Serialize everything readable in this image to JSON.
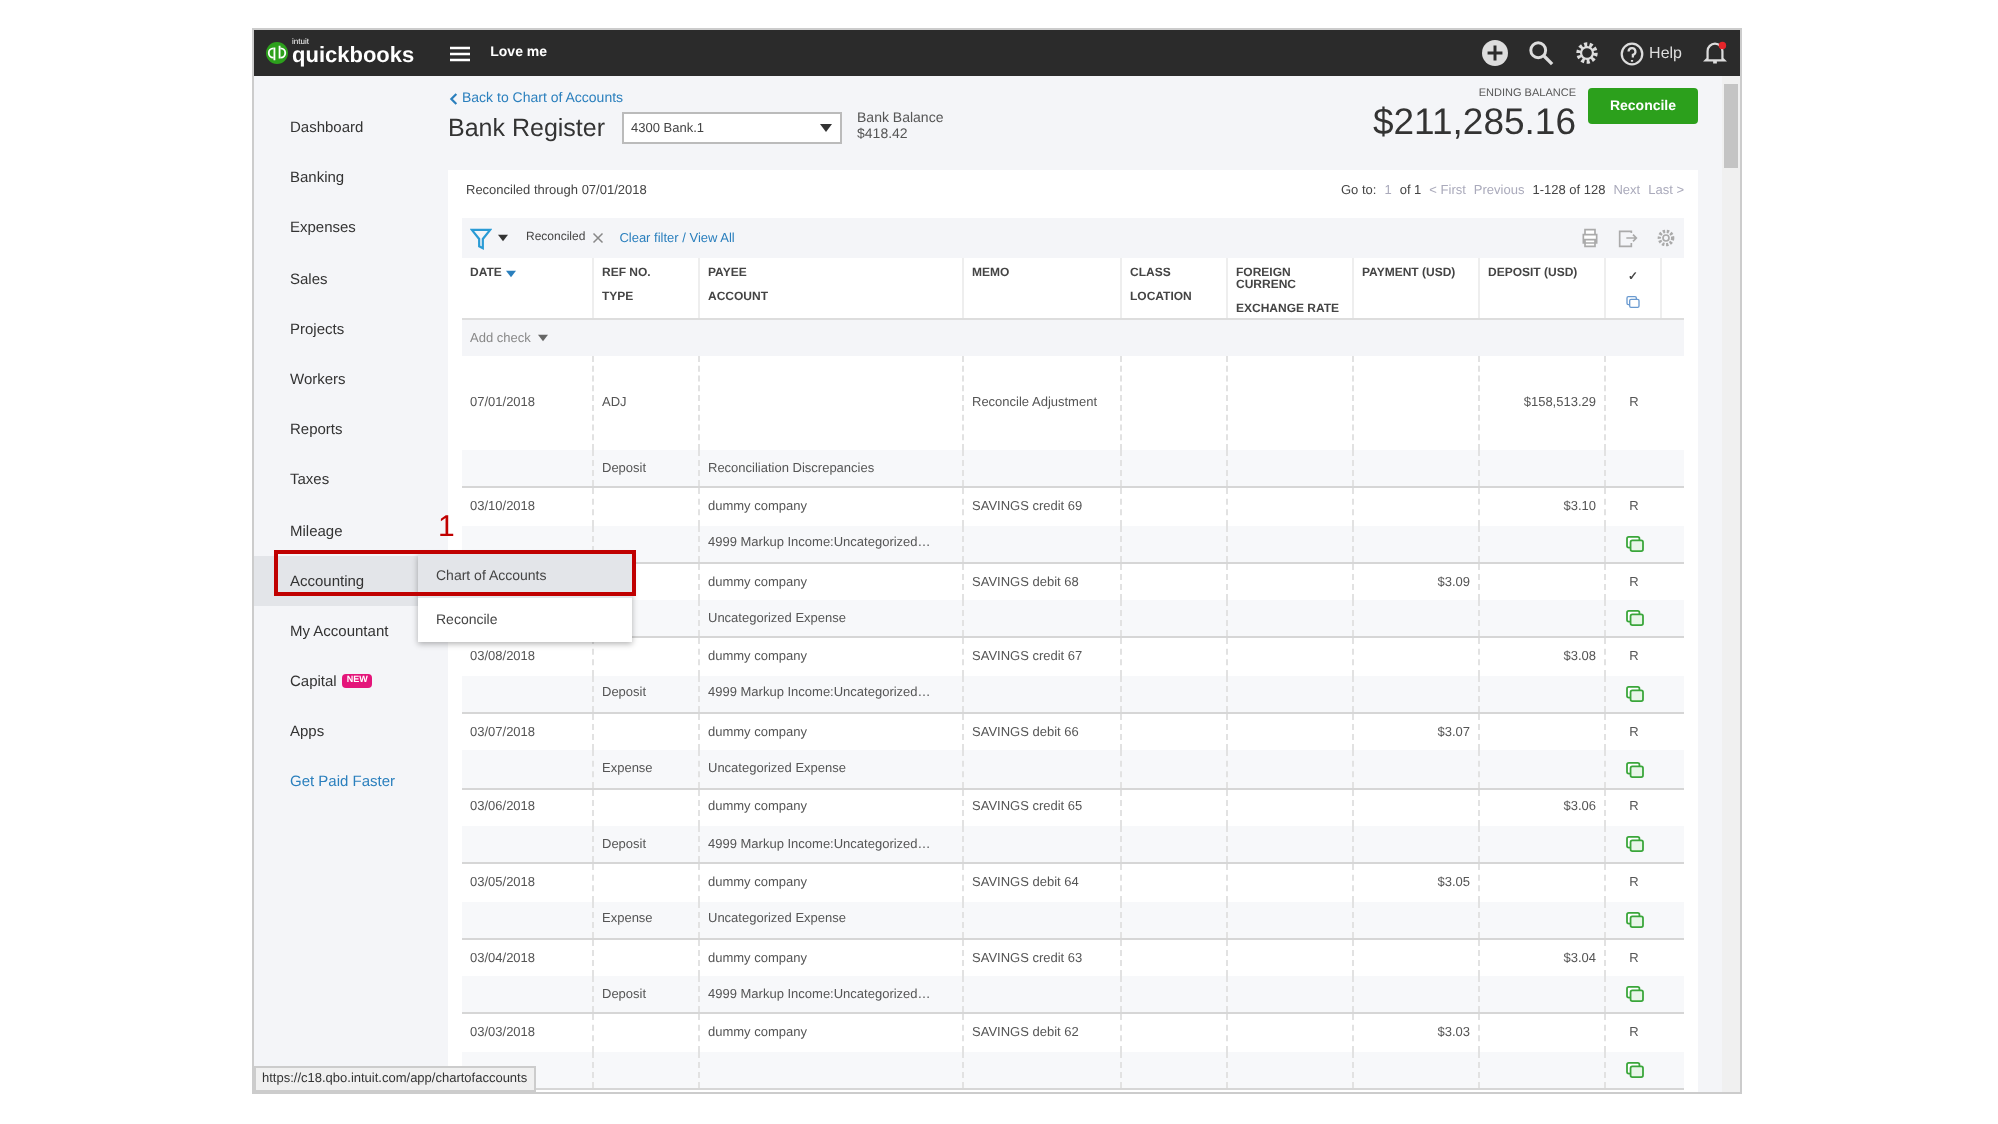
{
  "topbar": {
    "logo_small": "intuit",
    "logo": "quickbooks",
    "company": "Love me",
    "help": "Help",
    "notification": true
  },
  "sidebar": {
    "items": [
      {
        "label": "Dashboard",
        "selected": false,
        "kind": "nav"
      },
      {
        "label": "Banking",
        "selected": false,
        "kind": "nav"
      },
      {
        "label": "Expenses",
        "selected": false,
        "kind": "nav"
      },
      {
        "label": "Sales",
        "selected": false,
        "kind": "nav"
      },
      {
        "label": "Projects",
        "selected": false,
        "kind": "nav"
      },
      {
        "label": "Workers",
        "selected": false,
        "kind": "nav"
      },
      {
        "label": "Reports",
        "selected": false,
        "kind": "nav"
      },
      {
        "label": "Taxes",
        "selected": false,
        "kind": "nav"
      },
      {
        "label": "Mileage",
        "selected": false,
        "kind": "nav"
      },
      {
        "label": "Accounting",
        "selected": true,
        "kind": "nav"
      },
      {
        "label": "My Accountant",
        "selected": false,
        "kind": "nav"
      },
      {
        "label": "Capital",
        "selected": false,
        "kind": "nav",
        "badge": "NEW"
      },
      {
        "label": "Apps",
        "selected": false,
        "kind": "nav"
      },
      {
        "label": "Get Paid Faster",
        "selected": false,
        "kind": "link"
      }
    ]
  },
  "flyout": {
    "items": [
      {
        "label": "Chart of Accounts",
        "selected": true
      },
      {
        "label": "Reconcile",
        "selected": false
      }
    ]
  },
  "annotation": {
    "label": "1"
  },
  "header": {
    "back_link": "Back to Chart of Accounts",
    "title": "Bank Register",
    "account": "4300 Bank.1",
    "bank_balance_label": "Bank Balance",
    "bank_balance": "$418.42",
    "ending_balance_label": "ENDING BALANCE",
    "ending_balance": "$211,285.16",
    "reconcile_button": "Reconcile"
  },
  "pager": {
    "reconciled_through": "Reconciled through 07/01/2018",
    "goto": "Go to:",
    "page": "1",
    "of": "of 1",
    "nav": [
      {
        "label": "< First",
        "disabled": true
      },
      {
        "label": "Previous",
        "disabled": true
      },
      {
        "label": "1-128 of 128",
        "disabled": false
      },
      {
        "label": "Next",
        "disabled": true
      },
      {
        "label": "Last >",
        "disabled": true
      }
    ]
  },
  "filter": {
    "chip": "Reconciled",
    "clear_link": "Clear filter / View All"
  },
  "columns": [
    {
      "line1": "DATE",
      "sorted": true
    },
    {
      "line1": "REF NO.",
      "line2": "TYPE",
      "sorted": false
    },
    {
      "line1": "PAYEE",
      "line2": "ACCOUNT",
      "sorted": false
    },
    {
      "line1": "MEMO",
      "sorted": false
    },
    {
      "line1": "CLASS",
      "line2": "LOCATION",
      "sorted": false
    },
    {
      "line1": "FOREIGN CURRENC",
      "line2": "EXCHANGE RATE",
      "sorted": false
    },
    {
      "line1": "PAYMENT (USD)",
      "sorted": false
    },
    {
      "line1": "DEPOSIT (USD)",
      "sorted": false
    }
  ],
  "check_column": "✓",
  "add_check": "Add check",
  "rows": [
    {
      "kind": "adjustment",
      "date": "07/01/2018",
      "ref": "ADJ",
      "payee": "",
      "memo": "Reconcile Adjustment",
      "payment": "",
      "deposit": "$158,513.29",
      "status": "R",
      "type": "Deposit",
      "account": "Reconciliation Discrepancies",
      "attachment": false
    },
    {
      "kind": "entry",
      "date": "03/10/2018",
      "ref": "",
      "payee": "dummy company",
      "memo": "SAVINGS credit 69",
      "payment": "",
      "deposit": "$3.10",
      "status": "R",
      "type": "",
      "account": "4999 Markup Income:Uncategorized…",
      "attachment": true
    },
    {
      "kind": "entry",
      "date": "",
      "ref": "",
      "payee": "dummy company",
      "memo": "SAVINGS debit 68",
      "payment": "$3.09",
      "deposit": "",
      "status": "R",
      "type": "",
      "account": "Uncategorized Expense",
      "attachment": true
    },
    {
      "kind": "entry",
      "date": "03/08/2018",
      "ref": "",
      "payee": "dummy company",
      "memo": "SAVINGS credit 67",
      "payment": "",
      "deposit": "$3.08",
      "status": "R",
      "type": "Deposit",
      "account": "4999 Markup Income:Uncategorized…",
      "attachment": true
    },
    {
      "kind": "entry",
      "date": "03/07/2018",
      "ref": "",
      "payee": "dummy company",
      "memo": "SAVINGS debit 66",
      "payment": "$3.07",
      "deposit": "",
      "status": "R",
      "type": "Expense",
      "account": "Uncategorized Expense",
      "attachment": true
    },
    {
      "kind": "entry",
      "date": "03/06/2018",
      "ref": "",
      "payee": "dummy company",
      "memo": "SAVINGS credit 65",
      "payment": "",
      "deposit": "$3.06",
      "status": "R",
      "type": "Deposit",
      "account": "4999 Markup Income:Uncategorized…",
      "attachment": true
    },
    {
      "kind": "entry",
      "date": "03/05/2018",
      "ref": "",
      "payee": "dummy company",
      "memo": "SAVINGS debit 64",
      "payment": "$3.05",
      "deposit": "",
      "status": "R",
      "type": "Expense",
      "account": "Uncategorized Expense",
      "attachment": true
    },
    {
      "kind": "entry",
      "date": "03/04/2018",
      "ref": "",
      "payee": "dummy company",
      "memo": "SAVINGS credit 63",
      "payment": "",
      "deposit": "$3.04",
      "status": "R",
      "type": "Deposit",
      "account": "4999 Markup Income:Uncategorized…",
      "attachment": true
    },
    {
      "kind": "entry",
      "date": "03/03/2018",
      "ref": "",
      "payee": "dummy company",
      "memo": "SAVINGS debit 62",
      "payment": "$3.03",
      "deposit": "",
      "status": "R",
      "type": "",
      "account": "",
      "attachment": true
    }
  ],
  "status_url": "https://c18.qbo.intuit.com/app/chartofaccounts"
}
